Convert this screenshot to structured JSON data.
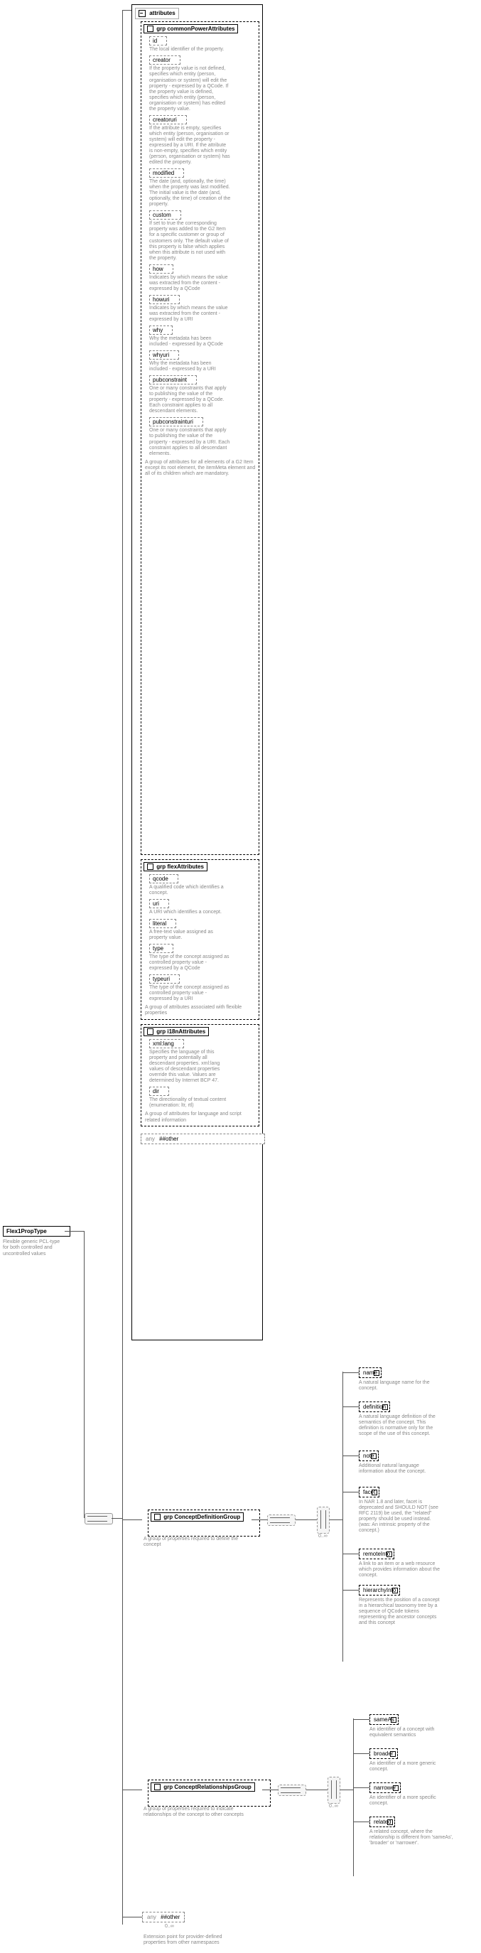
{
  "root": {
    "name": "Flex1PropType",
    "desc": "Flexible generic PCL-type for both controlled and uncontrolled values"
  },
  "attributes_panel_title": "attributes",
  "grp_prefix": "grp",
  "commonPower": {
    "name": "commonPowerAttributes",
    "items": [
      {
        "name": "id",
        "desc": "The local identifier of the property."
      },
      {
        "name": "creator",
        "desc": "If the property value is not defined, specifies which entity (person, organisation or system) will edit the property - expressed by a QCode. If the property value is defined, specifies which entity (person, organisation or system) has edited the property value."
      },
      {
        "name": "creatoruri",
        "desc": "If the attribute is empty, specifies which entity (person, organisation or system) will edit the property - expressed by a URI. If the attribute is non-empty, specifies which entity (person, organisation or system) has edited the property."
      },
      {
        "name": "modified",
        "desc": "The date (and, optionally, the time) when the property was last modified. The initial value is the date (and, optionally, the time) of creation of the property."
      },
      {
        "name": "custom",
        "desc": "If set to true the corresponding property was added to the G2 Item for a specific customer or group of customers only. The default value of this property is false which applies when this attribute is not used with the property."
      },
      {
        "name": "how",
        "desc": "Indicates by which means the value was extracted from the content - expressed by a QCode"
      },
      {
        "name": "howuri",
        "desc": "Indicates by which means the value was extracted from the content - expressed by a URI"
      },
      {
        "name": "why",
        "desc": "Why the metadata has been included - expressed by a QCode"
      },
      {
        "name": "whyuri",
        "desc": "Why the metadata has been included - expressed by a URI"
      },
      {
        "name": "pubconstraint",
        "desc": "One or many constraints that apply to publishing the value of the property - expressed by a QCode. Each constraint applies to all descendant elements."
      },
      {
        "name": "pubconstrainturi",
        "desc": "One or many constraints that apply to publishing the value of the property - expressed by a URI. Each constraint applies to all descendant elements."
      }
    ],
    "desc": "A group of attributes for all elements of a G2 Item except its root element, the itemMeta element and all of its children which are mandatory."
  },
  "flexAttrs": {
    "name": "flexAttributes",
    "items": [
      {
        "name": "qcode",
        "desc": "A qualified code which identifies a concept."
      },
      {
        "name": "uri",
        "desc": "A URI which identifies a concept."
      },
      {
        "name": "literal",
        "desc": "A free-text value assigned as property value."
      },
      {
        "name": "type",
        "desc": "The type of the concept assigned as controlled property value - expressed by a QCode"
      },
      {
        "name": "typeuri",
        "desc": "The type of the concept assigned as controlled property value - expressed by a URI"
      }
    ],
    "desc": "A group of attributes associated with flexible properties"
  },
  "i18nAttrs": {
    "name": "i18nAttributes",
    "items": [
      {
        "name": "xml:lang",
        "desc": "Specifies the language of this property and potentially all descendant properties. xml:lang values of descendant properties override this value. Values are determined by Internet BCP 47."
      },
      {
        "name": "dir",
        "desc": "The directionality of textual content (enumeration: ltr, rtl)"
      }
    ],
    "desc": "A group of attributes for language and script related information"
  },
  "any_label": "any",
  "any_value": "##other",
  "conceptDef": {
    "name": "ConceptDefinitionGroup",
    "desc": "A group of properties required to define the concept",
    "card": "0..∞",
    "items": [
      {
        "name": "name",
        "desc": "A natural language name for the concept."
      },
      {
        "name": "definition",
        "desc": "A natural language definition of the semantics of the concept. This definition is normative only for the scope of the use of this concept."
      },
      {
        "name": "note",
        "desc": "Additional natural language information about the concept."
      },
      {
        "name": "facet",
        "desc": "In NAR 1.8 and later, facet is deprecated and SHOULD NOT (see RFC 2119) be used, the \"related\" property should be used instead. (was: An intrinsic property of the concept.)"
      },
      {
        "name": "remoteInfo",
        "desc": "A link to an item or a web resource which provides information about the concept."
      },
      {
        "name": "hierarchyInfo",
        "desc": "Represents the position of a concept in a hierarchical taxonomy tree by a sequence of QCode tokens representing the ancestor concepts and this concept"
      }
    ]
  },
  "conceptRel": {
    "name": "ConceptRelationshipsGroup",
    "desc": "A group of properties required to indicate relationships of the concept to other concepts",
    "card": "0..∞",
    "items": [
      {
        "name": "sameAs",
        "desc": "An identifier of a concept with equivalent semantics"
      },
      {
        "name": "broader",
        "desc": "An identifier of a more generic concept."
      },
      {
        "name": "narrower",
        "desc": "An identifier of a more specific concept."
      },
      {
        "name": "related",
        "desc": "A related concept, where the relationship is different from 'sameAs', 'broader' or 'narrower'."
      }
    ]
  },
  "ext": {
    "card": "0..∞",
    "desc": "Extension point for provider-defined properties from other namespaces"
  }
}
